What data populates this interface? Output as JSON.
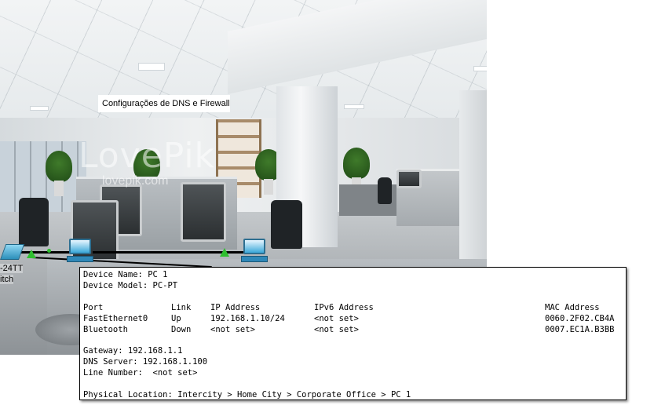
{
  "area_label": "Configurações de DNS e Firewall",
  "watermark": {
    "brand": "LovePik",
    "url": "lovepik.com"
  },
  "switch_label": {
    "model_fragment": "-24TT",
    "type_fragment": "itch"
  },
  "tooltip": {
    "device_name_label": "Device Name:",
    "device_name": "PC 1",
    "device_model_label": "Device Model:",
    "device_model": "PC-PT",
    "headers": {
      "port": "Port",
      "link": "Link",
      "ip": "IP Address",
      "ipv6": "IPv6 Address",
      "mac": "MAC Address"
    },
    "interfaces": [
      {
        "port": "FastEthernet0",
        "link": "Up",
        "ip": "192.168.1.10/24",
        "ipv6": "<not set>",
        "mac": "0060.2F02.CB4A"
      },
      {
        "port": "Bluetooth",
        "link": "Down",
        "ip": "<not set>",
        "ipv6": "<not set>",
        "mac": "0007.EC1A.B3BB"
      }
    ],
    "gateway_label": "Gateway:",
    "gateway": "192.168.1.1",
    "dns_label": "DNS Server:",
    "dns": "192.168.1.100",
    "line_number_label": "Line Number:",
    "line_number": "<not set>",
    "location_label": "Physical Location:",
    "location": "Intercity > Home City > Corporate Office > PC 1"
  },
  "colors": {
    "link_up": "#2fbf2f",
    "pc_icon": "#3aa8d8",
    "tooltip_border": "#000000"
  }
}
